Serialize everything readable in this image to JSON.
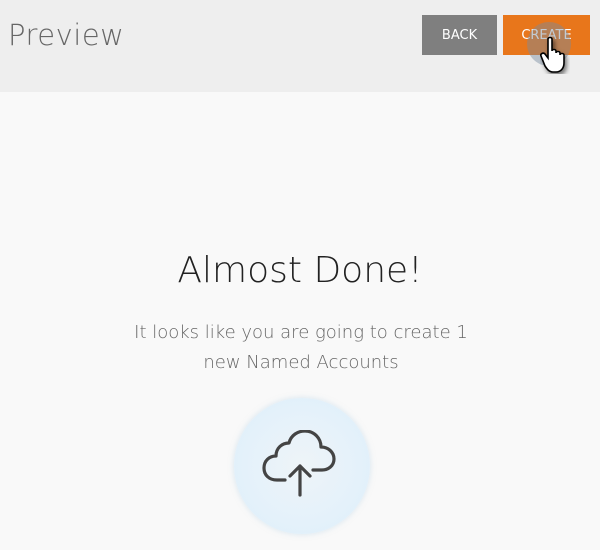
{
  "header": {
    "title": "Preview",
    "back_label": "BACK",
    "create_label": "CREATE"
  },
  "colors": {
    "create": "#e8761b",
    "back": "#7f7f7f"
  },
  "main": {
    "heading": "Almost Done!",
    "message": "It looks like you are going to create 1 new Named Accounts",
    "icon": "cloud-upload-icon"
  }
}
